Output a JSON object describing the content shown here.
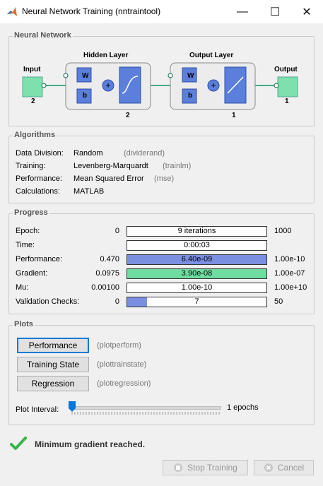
{
  "window": {
    "title": "Neural Network Training (nntraintool)",
    "controls": [
      "—",
      "☐",
      "✕"
    ]
  },
  "network": {
    "section_title": "Neural Network",
    "input_label": "Input",
    "input_size": "2",
    "hidden_label": "Hidden Layer",
    "hidden_size": "2",
    "output_layer_label": "Output Layer",
    "output_layer_size": "1",
    "output_label": "Output",
    "output_size": "1",
    "w": "W",
    "b": "b"
  },
  "algorithms": {
    "section_title": "Algorithms",
    "rows": [
      {
        "label": "Data Division:",
        "value": "Random",
        "fn": "(dividerand)"
      },
      {
        "label": "Training:",
        "value": "Levenberg-Marquardt",
        "fn": "(trainlm)"
      },
      {
        "label": "Performance:",
        "value": "Mean Squared Error",
        "fn": "(mse)"
      },
      {
        "label": "Calculations:",
        "value": "MATLAB",
        "fn": ""
      }
    ]
  },
  "progress": {
    "section_title": "Progress",
    "rows": [
      {
        "label": "Epoch:",
        "start": "0",
        "text": "9 iterations",
        "end": "1000",
        "fraction": 0.009,
        "color": "#ffffff"
      },
      {
        "label": "Time:",
        "start": "",
        "text": "0:00:03",
        "end": "",
        "fraction": 0,
        "color": "#ffffff"
      },
      {
        "label": "Performance:",
        "start": "0.470",
        "text": "6.40e-09",
        "end": "1.00e-10",
        "fraction": 1.0,
        "color": "#7b8fe0"
      },
      {
        "label": "Gradient:",
        "start": "0.0975",
        "text": "3.90e-08",
        "end": "1.00e-07",
        "fraction": 1.0,
        "color": "#6fdca0"
      },
      {
        "label": "Mu:",
        "start": "0.00100",
        "text": "1.00e-10",
        "end": "1.00e+10",
        "fraction": 0,
        "color": "#ffffff"
      },
      {
        "label": "Validation Checks:",
        "start": "0",
        "text": "7",
        "end": "50",
        "fraction": 0.14,
        "color": "#7b8fe0"
      }
    ]
  },
  "plots": {
    "section_title": "Plots",
    "buttons": [
      {
        "label": "Performance",
        "fn": "(plotperform)"
      },
      {
        "label": "Training State",
        "fn": "(plottrainstate)"
      },
      {
        "label": "Regression",
        "fn": "(plotregression)"
      }
    ],
    "interval_label": "Plot Interval:",
    "interval_value": "1 epochs",
    "interval_fraction": 0.0
  },
  "status": {
    "message": "Minimum gradient reached."
  },
  "actions": {
    "stop_label": "Stop Training",
    "cancel_label": "Cancel"
  }
}
